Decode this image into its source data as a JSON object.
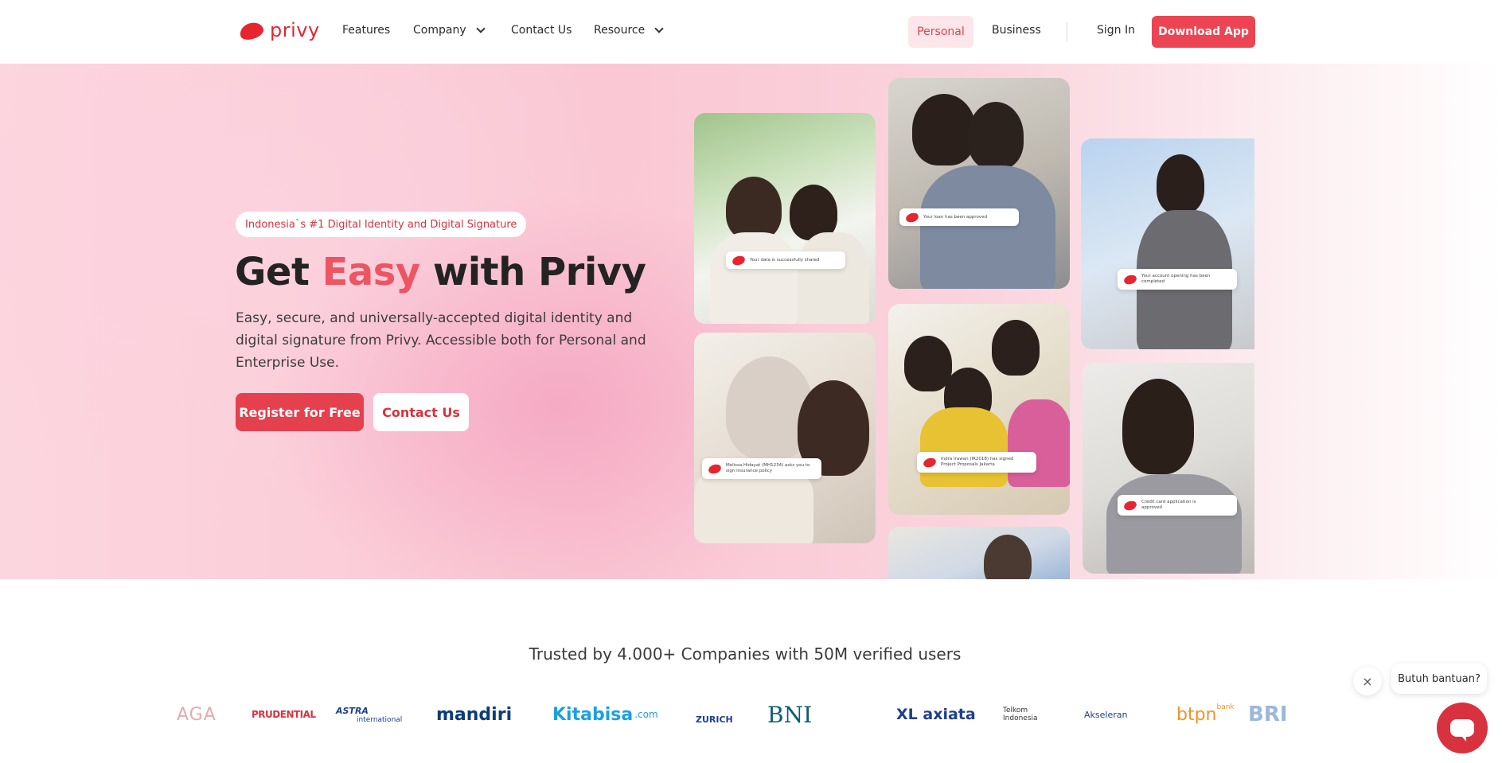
{
  "nav": {
    "logo_text": "privy",
    "items": [
      {
        "label": "Features"
      },
      {
        "label": "Company"
      },
      {
        "label": "Contact Us"
      },
      {
        "label": "Resource"
      }
    ],
    "personal": "Personal",
    "business": "Business",
    "sign_in": "Sign In",
    "download": "Download App"
  },
  "hero": {
    "badge": "Indonesia`s #1 Digital Identity and Digital Signature",
    "headline_pre": "Get ",
    "headline_accent": "Easy",
    "headline_post": " with Privy",
    "subtext": "Easy, secure, and universally-accepted digital identity and digital signature from Privy. Accessible both for Personal and Enterprise Use.",
    "register_btn": "Register for Free",
    "contact_btn": "Contact Us"
  },
  "photos": [
    {
      "notif": "Your data is successfully shared"
    },
    {
      "notif": "Your loan has been approved"
    },
    {
      "notif": "Your account opening has been completed"
    },
    {
      "notif": "Melissa Hidayat (MH1234) asks you to sign insurance policy"
    },
    {
      "notif": "Indra Irawan (IR2018) has signed Project Proposals Jakarta"
    },
    {
      "notif": "Credit card application is approved"
    }
  ],
  "trusted": {
    "title": "Trusted by 4.000+ Companies with 50M verified users",
    "brands": [
      "AGA",
      "PRUDENTIAL",
      "ASTRA",
      "international",
      "mandiri",
      "Kitabisa",
      ".com",
      "ZURICH",
      "BNI",
      "XL axiata",
      "Telkom",
      "Indonesia",
      "Akseleran",
      "btpn",
      "bank",
      "BRI"
    ]
  },
  "chat": {
    "bubble": "Butuh bantuan?",
    "close": "×"
  }
}
